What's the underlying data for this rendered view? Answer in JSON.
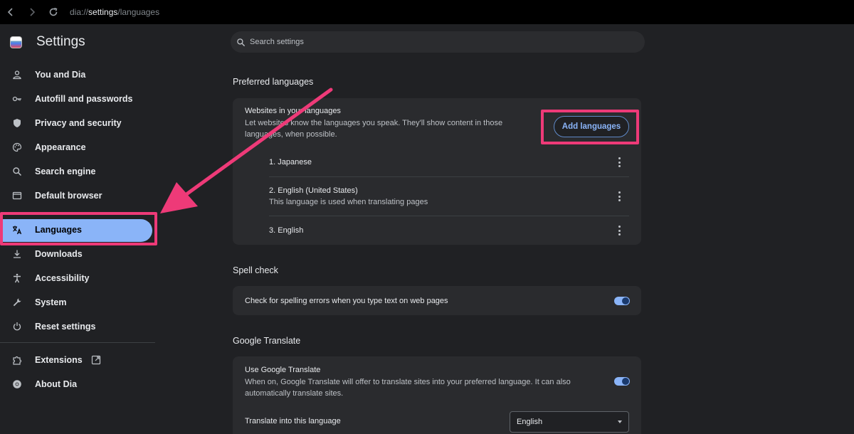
{
  "address_bar": {
    "prefix": "dia://",
    "host": "settings",
    "path": "/languages"
  },
  "sidebar": {
    "title": "Settings",
    "items": [
      {
        "label": "You and Dia",
        "icon": "person-icon"
      },
      {
        "label": "Autofill and passwords",
        "icon": "key-icon"
      },
      {
        "label": "Privacy and security",
        "icon": "shield-icon"
      },
      {
        "label": "Appearance",
        "icon": "palette-icon"
      },
      {
        "label": "Search engine",
        "icon": "search-icon"
      },
      {
        "label": "Default browser",
        "icon": "browser-window-icon"
      },
      {
        "label": "Languages",
        "icon": "translate-icon",
        "active": true
      },
      {
        "label": "Downloads",
        "icon": "download-icon"
      },
      {
        "label": "Accessibility",
        "icon": "accessibility-icon"
      },
      {
        "label": "System",
        "icon": "wrench-icon"
      },
      {
        "label": "Reset settings",
        "icon": "reset-icon"
      }
    ],
    "extensions_label": "Extensions",
    "about_label": "About Dia"
  },
  "search": {
    "placeholder": "Search settings"
  },
  "preferred": {
    "title": "Preferred languages",
    "card_title": "Websites in your languages",
    "card_desc_1": "Let websites know the languages you speak. They'll show content in those",
    "card_desc_2": "languages, when possible.",
    "add_button": "Add languages",
    "languages": [
      {
        "name": "1. Japanese",
        "note": ""
      },
      {
        "name": "2. English (United States)",
        "note": "This language is used when translating pages"
      },
      {
        "name": "3. English",
        "note": ""
      }
    ]
  },
  "spell": {
    "title": "Spell check",
    "label": "Check for spelling errors when you type text on web pages",
    "enabled": true
  },
  "translate": {
    "title": "Google Translate",
    "use_title": "Use Google Translate",
    "use_desc_1": "When on, Google Translate will offer to translate sites into your preferred language. It can also",
    "use_desc_2": "automatically translate sites.",
    "enabled": true,
    "into_label": "Translate into this language",
    "into_value": "English"
  },
  "colors": {
    "highlight": "#ee3a78",
    "accent": "#8ab4f8",
    "background": "#202124",
    "card": "#2a2b2e"
  }
}
